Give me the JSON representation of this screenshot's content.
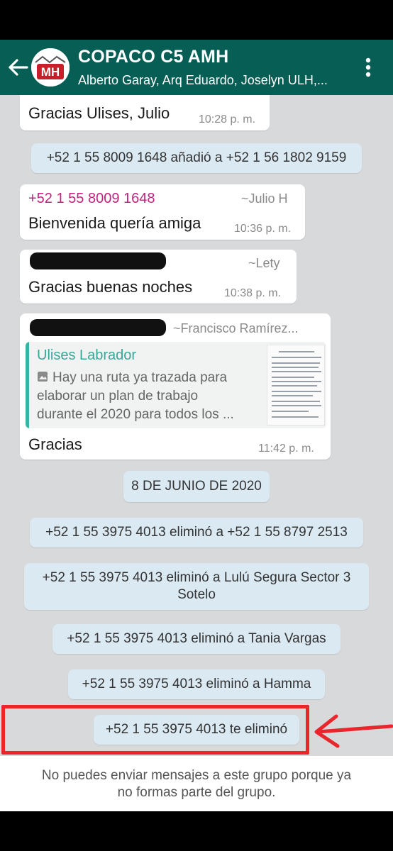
{
  "header": {
    "title": "COPACO C5 AMH",
    "members": "Alberto Garay, Arq Eduardo, Joselyn ULH,...",
    "avatar_text": "MH",
    "bg_color": "#075e54"
  },
  "messages": {
    "m1": {
      "text": "Gracias Ulises, Julio",
      "time": "10:28 p. m."
    },
    "sys1": "+52 1 55 8009 1648 añadió a +52 1 56 1802 9159",
    "m2": {
      "sender": "+52 1 55 8009 1648",
      "alias": "~Julio H",
      "text": "Bienvenida quería amiga",
      "time": "10:36 p. m."
    },
    "m3": {
      "alias": "~Lety",
      "text": "Gracias buenas noches",
      "time": "10:38 p. m."
    },
    "m4": {
      "alias": "~Francisco Ramírez...",
      "quote_author": "Ulises Labrador",
      "quote_line1": "Hay una ruta ya trazada para",
      "quote_line2": "elaborar un plan de trabajo",
      "quote_line3": "durante el 2020 para todos los ...",
      "text": "Gracias",
      "time": "11:42 p. m."
    },
    "date_divider": "8 DE JUNIO DE 2020",
    "sys2": "+52 1 55 3975 4013 eliminó a +52 1 55 8797 2513",
    "sys3_line1": "+52 1 55 3975 4013 eliminó a Lulú Segura Sector 3",
    "sys3_line2": "Sotelo",
    "sys4": "+52 1 55 3975 4013 eliminó a Tania Vargas",
    "sys5": "+52 1 55 3975 4013 eliminó a Hamma",
    "sys6": "+52 1 55 3975 4013 te eliminó"
  },
  "footer": {
    "line1": "No puedes enviar mensajes a este grupo porque ya",
    "line2": "no formas parte del grupo."
  },
  "colors": {
    "chat_bg": "#d8d9da",
    "system_bubble": "#dbe9f3",
    "sender_phone": "#c0247c",
    "quote_accent": "#35b5a3",
    "highlight": "#e8262b"
  },
  "icons": [
    "back-arrow-icon",
    "group-avatar-icon",
    "more-vert-icon",
    "image-icon"
  ]
}
